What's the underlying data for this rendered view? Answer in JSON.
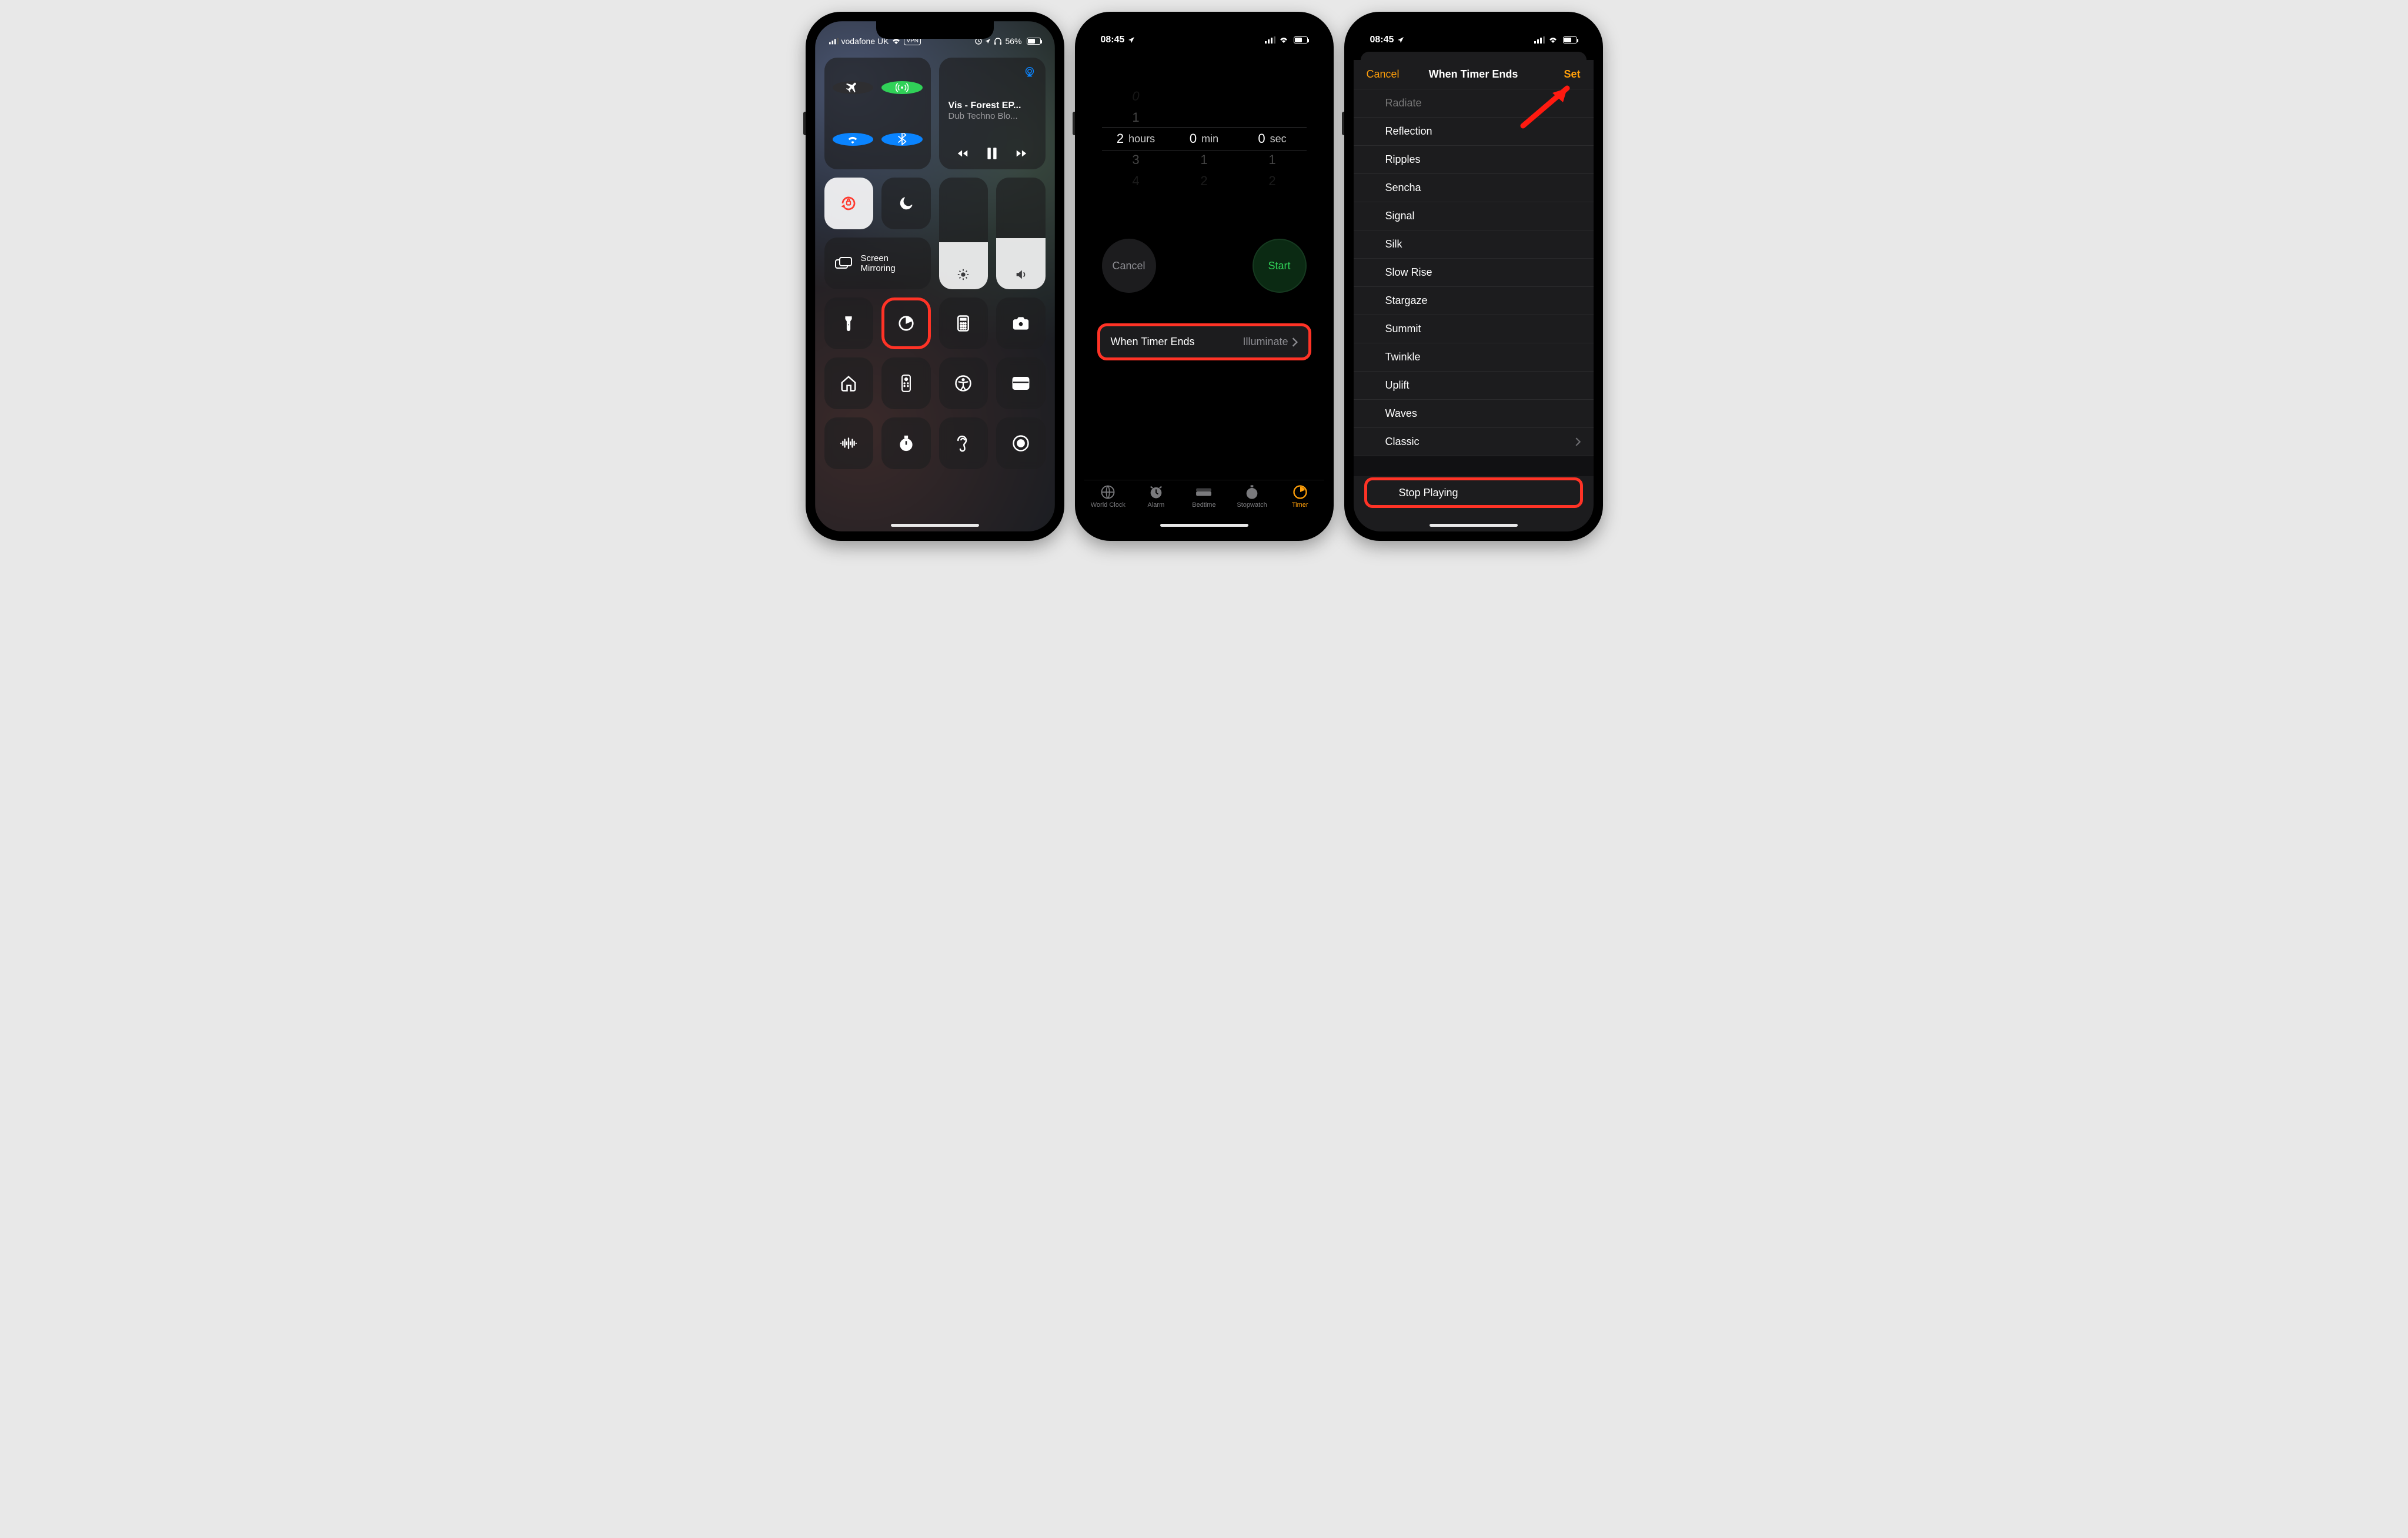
{
  "phone1": {
    "status": {
      "carrier": "vodafone UK",
      "vpn": "VPN",
      "battery_pct": "56%"
    },
    "media": {
      "title": "Vis - Forest EP...",
      "subtitle": "Dub Techno Blo..."
    },
    "mirroring_line1": "Screen",
    "mirroring_line2": "Mirroring"
  },
  "phone2": {
    "status_time": "08:45",
    "picker": {
      "hours_above2": "0",
      "hours_above1": "1",
      "hours_sel": "2",
      "hours_below1": "3",
      "hours_below2": "4",
      "hours_unit": "hours",
      "min_sel": "0",
      "min_below1": "1",
      "min_below2": "2",
      "min_unit": "min",
      "sec_sel": "0",
      "sec_below1": "1",
      "sec_below2": "2",
      "sec_unit": "sec"
    },
    "cancel": "Cancel",
    "start": "Start",
    "when_label": "When Timer Ends",
    "when_value": "Illuminate",
    "tabs": {
      "world": "World Clock",
      "alarm": "Alarm",
      "bedtime": "Bedtime",
      "stopwatch": "Stopwatch",
      "timer": "Timer"
    }
  },
  "phone3": {
    "status_time": "08:45",
    "cancel": "Cancel",
    "title": "When Timer Ends",
    "set": "Set",
    "items": [
      "Radiate",
      "Reflection",
      "Ripples",
      "Sencha",
      "Signal",
      "Silk",
      "Slow Rise",
      "Stargaze",
      "Summit",
      "Twinkle",
      "Uplift",
      "Waves",
      "Classic"
    ],
    "stop": "Stop Playing"
  }
}
